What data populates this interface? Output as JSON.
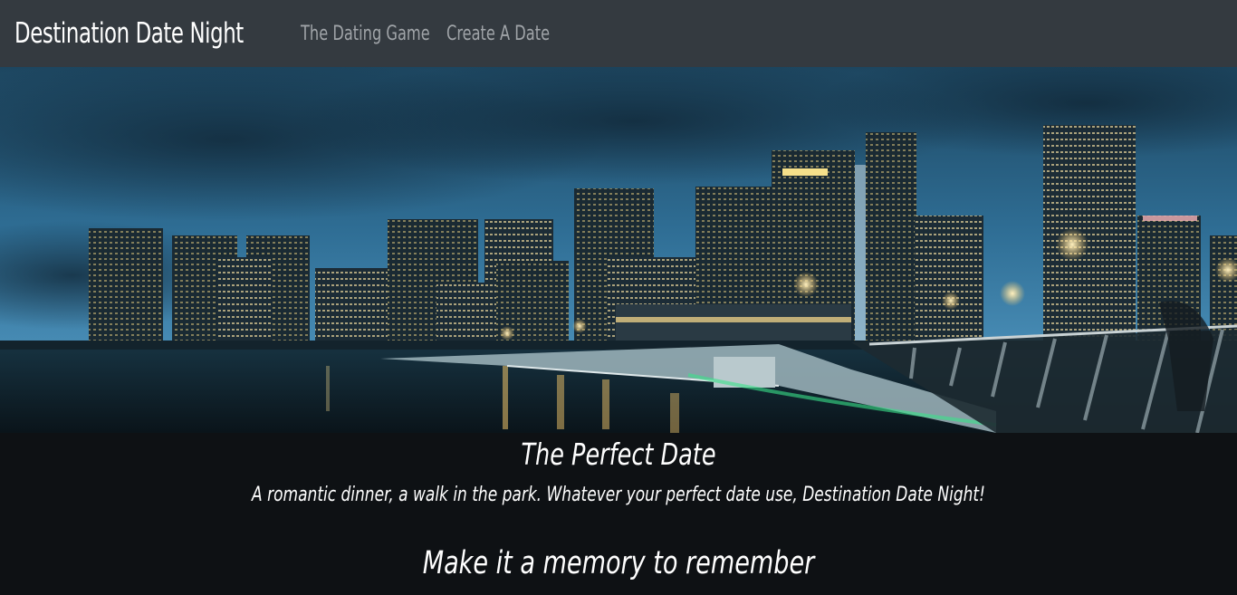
{
  "navbar": {
    "brand": "Destination Date Night",
    "links": [
      "The Dating Game",
      "Create A Date"
    ]
  },
  "hero": {
    "image": "city-skyline-at-night",
    "colors": {
      "sky_top": "#1f4a66",
      "sky_bottom": "#3f86b3",
      "water": "#0d1a22"
    }
  },
  "content": {
    "title": "The Perfect Date",
    "subtitle": "A romantic dinner, a walk in the park. Whatever your perfect date use, Destination Date Night!",
    "tagline": "Make it a memory to remember"
  },
  "colors": {
    "navbar_bg": "#343a40",
    "page_bg": "#0e1114",
    "link": "#a0a4a8"
  }
}
